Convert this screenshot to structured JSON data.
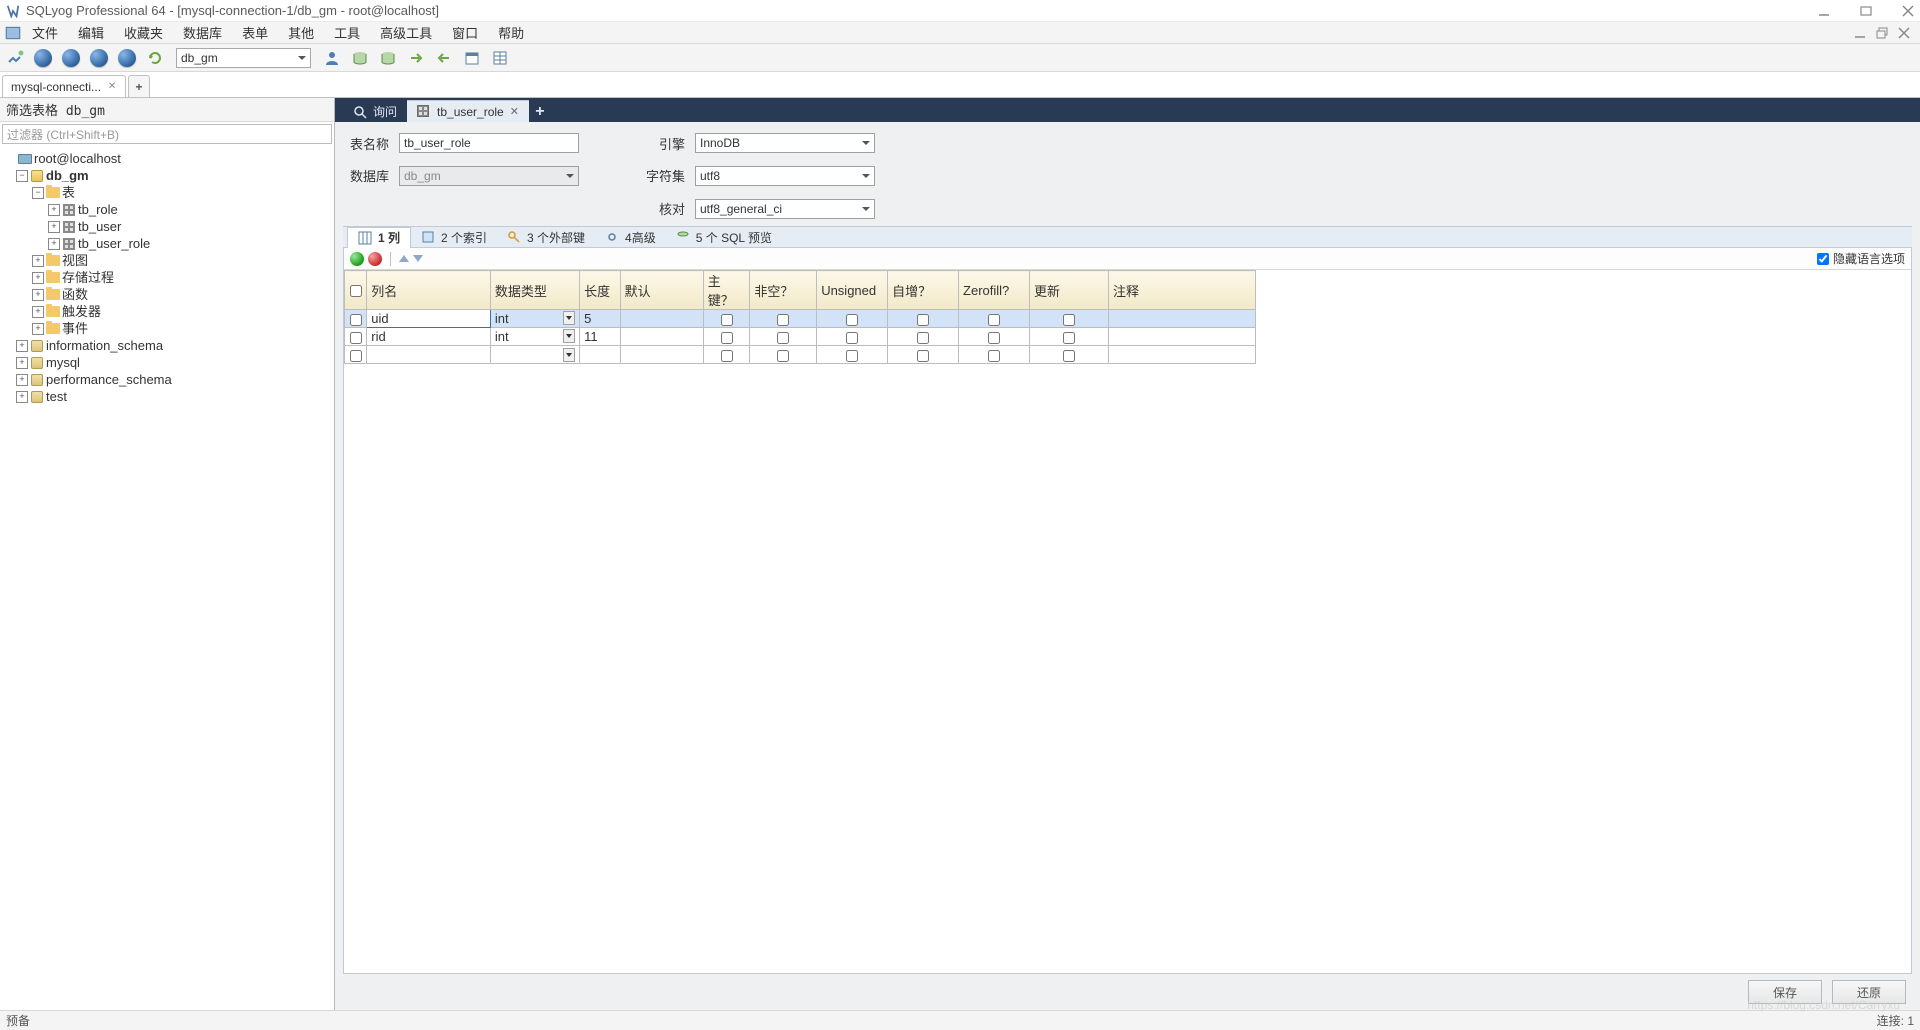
{
  "window": {
    "title": "SQLyog Professional 64 - [mysql-connection-1/db_gm - root@localhost]"
  },
  "menu": {
    "items": [
      "文件",
      "编辑",
      "收藏夹",
      "数据库",
      "表单",
      "其他",
      "工具",
      "高级工具",
      "窗口",
      "帮助"
    ]
  },
  "toolbar": {
    "db_combo": "db_gm"
  },
  "conn_tabs": {
    "main": "mysql-connecti..."
  },
  "left": {
    "filter_label": "筛选表格 db_gm",
    "filter_placeholder": "过滤器 (Ctrl+Shift+B)",
    "root": "root@localhost",
    "db": "db_gm",
    "folders": {
      "tables": "表",
      "views": "视图",
      "procs": "存储过程",
      "funcs": "函数",
      "triggers": "触发器",
      "events": "事件"
    },
    "tables": [
      "tb_role",
      "tb_user",
      "tb_user_role"
    ],
    "other_dbs": [
      "information_schema",
      "mysql",
      "performance_schema",
      "test"
    ]
  },
  "editor_tabs": {
    "query": "询问",
    "table": "tb_user_role"
  },
  "form": {
    "table_name_lbl": "表名称",
    "table_name": "tb_user_role",
    "database_lbl": "数据库",
    "database": "db_gm",
    "engine_lbl": "引擎",
    "engine": "InnoDB",
    "charset_lbl": "字符集",
    "charset": "utf8",
    "collation_lbl": "核对",
    "collation": "utf8_general_ci"
  },
  "subtabs": {
    "columns": "1 列",
    "indexes": "2 个索引",
    "fks": "3 个外部键",
    "advanced": "4高级",
    "sql": "5 个 SQL 预览"
  },
  "grid": {
    "hide_lang": "隐藏语言选项",
    "headers": {
      "name": "列名",
      "datatype": "数据类型",
      "length": "长度",
      "default": "默认",
      "pk": "主键？",
      "notnull": "非空？",
      "unsigned": "Unsigned",
      "autoincr": "自增？",
      "zerofill": "Zerofill?",
      "update": "更新",
      "comment": "注释"
    },
    "rows": [
      {
        "name": "uid",
        "datatype": "int",
        "length": "5"
      },
      {
        "name": "rid",
        "datatype": "int",
        "length": "11"
      },
      {
        "name": "",
        "datatype": "",
        "length": ""
      }
    ]
  },
  "footer": {
    "save": "保存",
    "revert": "还原"
  },
  "status": {
    "ready": "预备",
    "conn": "连接: 1",
    "watermark": "https://blog.csdn.net/Carryxu"
  }
}
